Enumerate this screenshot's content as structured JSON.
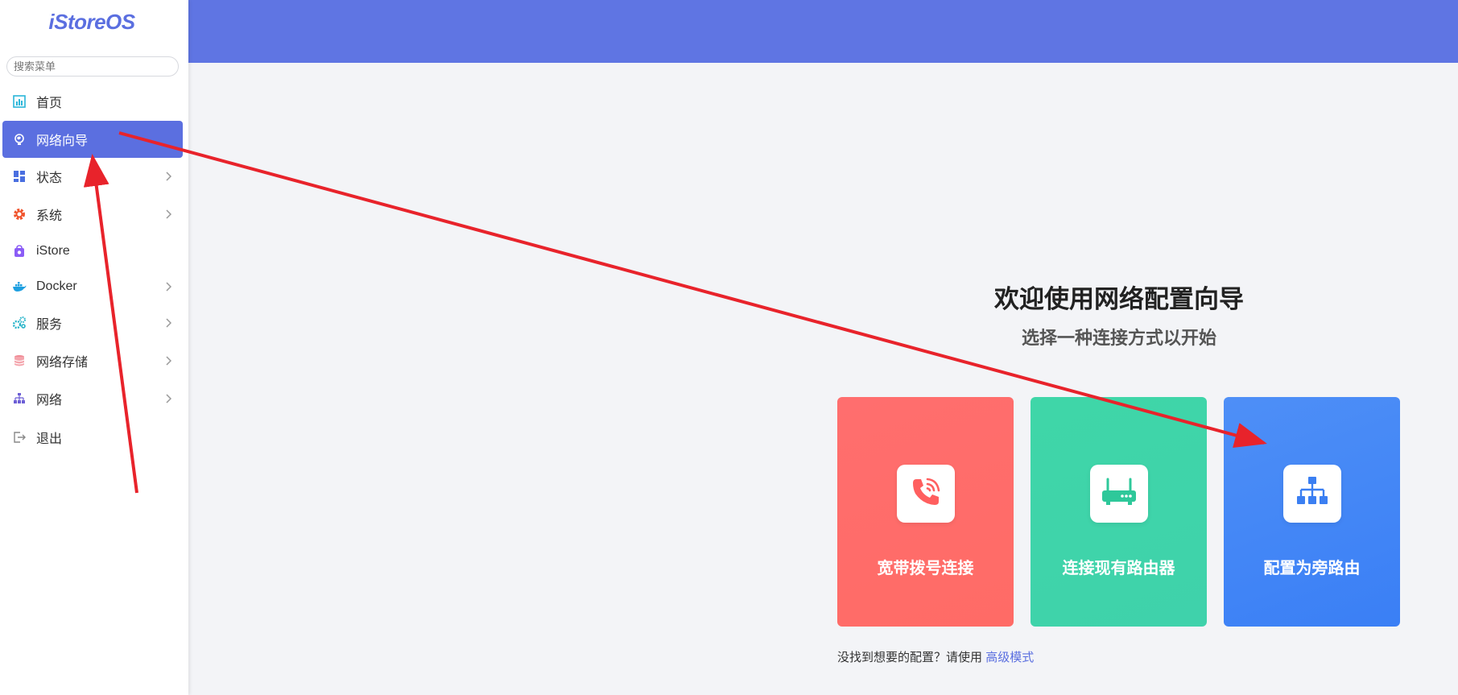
{
  "app": {
    "logo": "iStoreOS"
  },
  "sidebar": {
    "search_placeholder": "搜索菜单",
    "items": [
      {
        "label": "首页",
        "icon": "dashboard-icon",
        "chevron": false,
        "active": false
      },
      {
        "label": "网络向导",
        "icon": "globe-icon",
        "chevron": false,
        "active": true
      },
      {
        "label": "状态",
        "icon": "grid-icon",
        "chevron": true,
        "active": false
      },
      {
        "label": "系统",
        "icon": "gear-icon",
        "chevron": true,
        "active": false
      },
      {
        "label": "iStore",
        "icon": "store-bag-icon",
        "chevron": false,
        "active": false
      },
      {
        "label": "Docker",
        "icon": "docker-whale-icon",
        "chevron": true,
        "active": false
      },
      {
        "label": "服务",
        "icon": "cogs-icon",
        "chevron": true,
        "active": false
      },
      {
        "label": "网络存储",
        "icon": "database-icon",
        "chevron": true,
        "active": false
      },
      {
        "label": "网络",
        "icon": "network-tree-icon",
        "chevron": true,
        "active": false
      },
      {
        "label": "退出",
        "icon": "logout-icon",
        "chevron": false,
        "active": false
      }
    ]
  },
  "main": {
    "title": "欢迎使用网络配置向导",
    "subtitle": "选择一种连接方式以开始",
    "cards": [
      {
        "label": "宽带拨号连接",
        "icon": "phone-call-icon",
        "color": "#ff6b6b"
      },
      {
        "label": "连接现有路由器",
        "icon": "router-icon",
        "color": "#3fd4aa"
      },
      {
        "label": "配置为旁路由",
        "icon": "network-tree-icon",
        "color": "#4186f6"
      }
    ],
    "hint_text": "没找到想要的配置？请使用",
    "hint_link": "高级模式"
  },
  "colors": {
    "accent": "#5b6fe0",
    "topbar": "#5f75e3",
    "annotation_arrow": "#e8232b"
  }
}
